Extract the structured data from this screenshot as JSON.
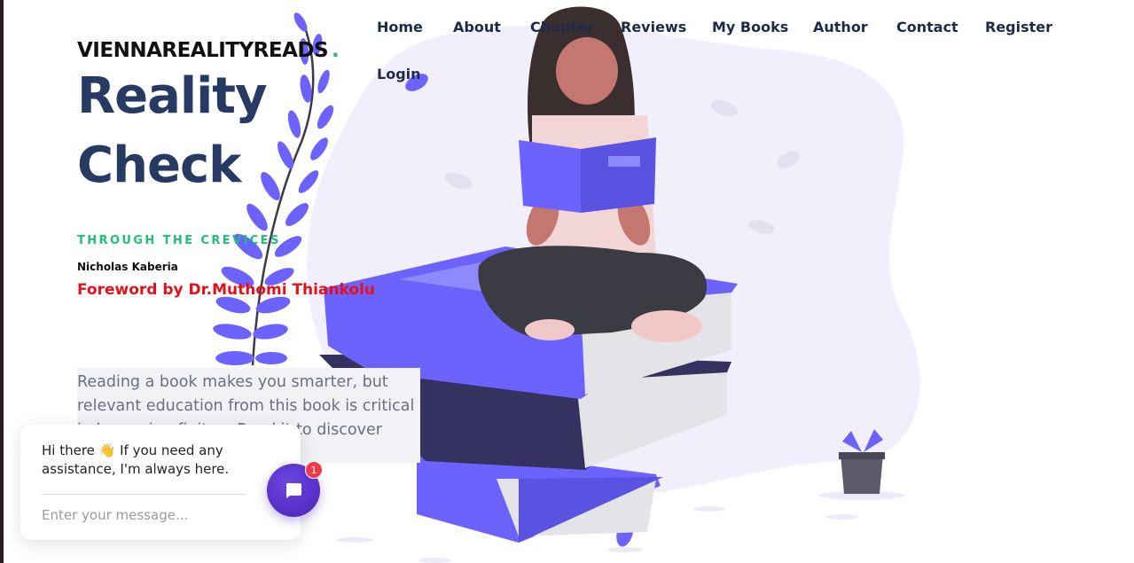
{
  "brand": {
    "name": "VIENNAREALITYREADS",
    "dot": "."
  },
  "nav": {
    "home": "Home",
    "about": "About",
    "chapter": "Chapter",
    "reviews": "Reviews",
    "my_books": "My Books",
    "author": "Author",
    "contact": "Contact",
    "register": "Register",
    "login": "Login"
  },
  "hero": {
    "title_line1": "Reality",
    "title_line2": "Check",
    "tagline": "THROUGH THE CREVICES",
    "author": "Nicholas Kaberia",
    "foreword": "Foreword by Dr.Muthomi Thiankolu",
    "intro": "Reading a book makes you smarter, but relevant education from this book is critical in becoming finite... Read it to discover topics -"
  },
  "chat": {
    "greeting": "Hi there 👋 If you need any assistance, I'm always here.",
    "input_placeholder": "Enter your message...",
    "badge_count": "1",
    "launcher_icon": "chat-bubble-icon"
  },
  "colors": {
    "accent": "#6c63ff",
    "title": "#263a63",
    "tagline": "#1fbf7a",
    "foreword": "#e5101a",
    "chat_launcher": "#5a2fd0",
    "badge": "#f03a4a"
  }
}
